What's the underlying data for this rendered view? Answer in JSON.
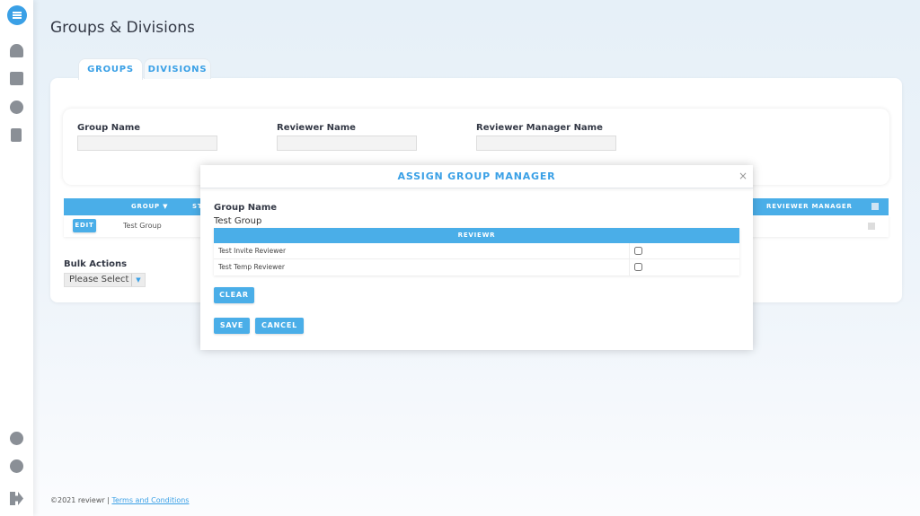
{
  "sidebar": {
    "items": [
      {
        "icon": "dashboard-gauge-icon"
      },
      {
        "icon": "calendar-icon"
      },
      {
        "icon": "gear-icon"
      },
      {
        "icon": "clipboard-icon"
      }
    ],
    "bottom": [
      {
        "icon": "lifebuoy-icon"
      },
      {
        "icon": "user-circle-icon"
      },
      {
        "icon": "sign-out-icon"
      }
    ]
  },
  "page": {
    "title": "Groups & Divisions"
  },
  "tabs": [
    {
      "label": "GROUPS",
      "active": true
    },
    {
      "label": "DIVISIONS",
      "active": false
    }
  ],
  "filters": {
    "group_name": "Group Name",
    "reviewer_name": "Reviewer Name",
    "reviewer_manager_name": "Reviewer Manager Name"
  },
  "table": {
    "headers": {
      "group": "GROUP",
      "status": "ST",
      "reviewer_manager": "REVIEWER MANAGER"
    },
    "rows": [
      {
        "edit": "EDIT",
        "group": "Test Group"
      }
    ]
  },
  "bulk": {
    "label": "Bulk Actions",
    "select": "Please Select"
  },
  "modal": {
    "title": "ASSIGN GROUP MANAGER",
    "close": "×",
    "group_label": "Group Name",
    "group_value": "Test Group",
    "column": "REVIEWR",
    "reviewers": [
      {
        "name": "Test Invite Reviewer",
        "checked": false
      },
      {
        "name": "Test Temp Reviewer",
        "checked": false
      }
    ],
    "clear": "CLEAR",
    "save": "SAVE",
    "cancel": "CANCEL"
  },
  "footer": {
    "copyright": "©2021 reviewr |",
    "link": "Terms and Conditions"
  },
  "colors": {
    "accent": "#4aaee8"
  }
}
